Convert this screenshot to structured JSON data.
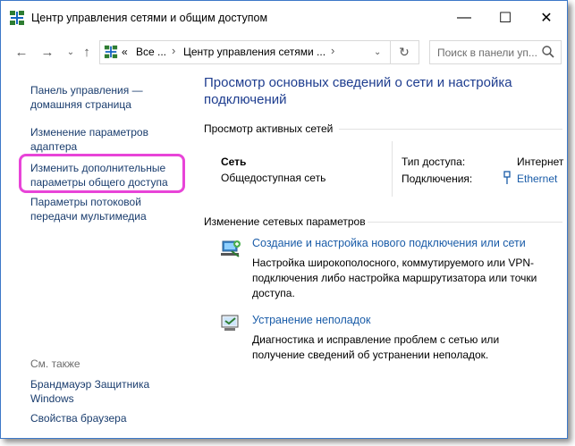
{
  "window": {
    "title": "Центр управления сетями и общим доступом",
    "minimize": "—",
    "maximize": "☐",
    "close": "✕"
  },
  "nav": {
    "back": "←",
    "forward": "→",
    "up": "↑",
    "address_prefix": "«",
    "address_part1": "Все ...",
    "address_sep": "›",
    "address_part2": "Центр управления сетями ...",
    "dropdown": "⌄",
    "refresh": "↻",
    "search_placeholder": "Поиск в панели уп..."
  },
  "sidebar": {
    "items": [
      {
        "label": "Панель управления — домашняя страница"
      },
      {
        "label": "Изменение параметров адаптера"
      },
      {
        "label": "Изменить дополнительные параметры общего доступа"
      },
      {
        "label": "Параметры потоковой передачи мультимедиа"
      }
    ],
    "see_also": "См. также",
    "see_also_items": [
      {
        "label": "Брандмауэр Защитника Windows"
      },
      {
        "label": "Свойства браузера"
      }
    ]
  },
  "main": {
    "title": "Просмотр основных сведений о сети и настройка подключений",
    "active_networks_header": "Просмотр активных сетей",
    "network_name": "Сеть",
    "network_type": "Общедоступная сеть",
    "access_type_label": "Тип доступа:",
    "access_type_value": "Интернет",
    "connections_label": "Подключения:",
    "connections_value": "Ethernet",
    "change_header": "Изменение сетевых параметров",
    "tasks": [
      {
        "title": "Создание и настройка нового подключения или сети",
        "desc": "Настройка широкополосного, коммутируемого или VPN-подключения либо настройка маршрутизатора или точки доступа."
      },
      {
        "title": "Устранение неполадок",
        "desc": "Диагностика и исправление проблем с сетью или получение сведений об устранении неполадок."
      }
    ]
  },
  "colors": {
    "accent": "#1e3d8f",
    "link": "#1a5ca8",
    "highlight": "#e844d8"
  }
}
